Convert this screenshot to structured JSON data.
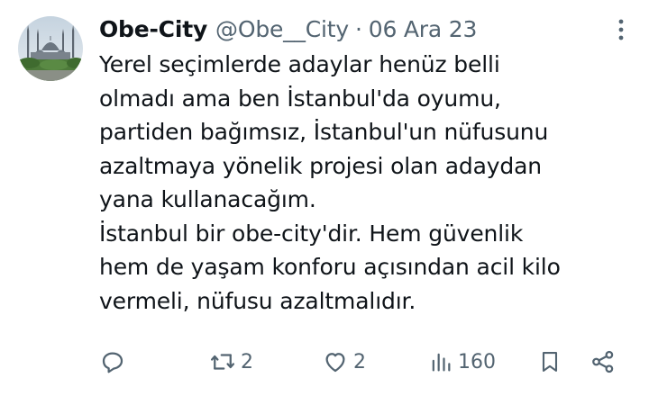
{
  "tweet": {
    "display_name": "Obe-City",
    "handle": "@Obe__City",
    "separator": "·",
    "date": "06 Ara 23",
    "lines": [
      "Yerel seçimlerde adaylar henüz belli",
      "olmadı ama ben İstanbul'da oyumu,",
      "partiden bağımsız, İstanbul'un nüfusunu",
      "azaltmaya yönelik projesi olan adaydan",
      "yana kullanacağım.",
      "İstanbul bir obe-city'dir. Hem güvenlik",
      "hem de yaşam konforu açısından acil kilo",
      "vermeli, nüfusu azaltmalıdır."
    ]
  },
  "actions": {
    "reply": {
      "icon": "reply-icon"
    },
    "retweet": {
      "icon": "retweet-icon",
      "count": "2"
    },
    "like": {
      "icon": "heart-icon",
      "count": "2"
    },
    "views": {
      "icon": "views-icon",
      "count": "160"
    },
    "bookmark": {
      "icon": "bookmark-icon"
    },
    "share": {
      "icon": "share-icon"
    }
  },
  "colors": {
    "text": "#0f1419",
    "secondary": "#536471",
    "background": "#ffffff"
  }
}
